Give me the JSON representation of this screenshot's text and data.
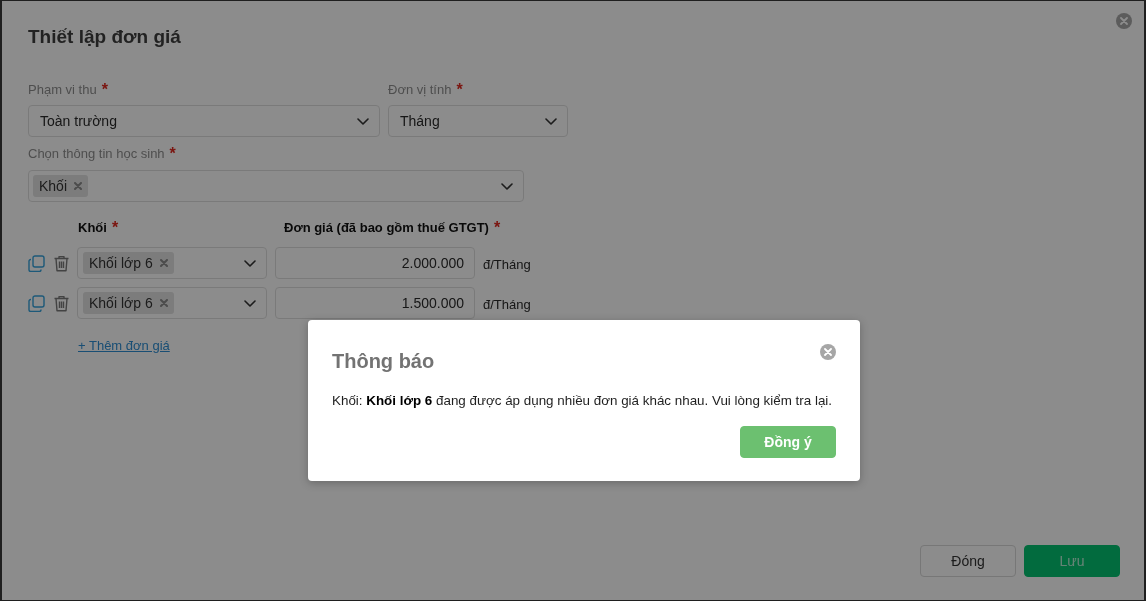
{
  "dialog": {
    "title": "Thiết lập đơn giá",
    "fields": [
      {
        "label": "Phạm vi thu",
        "required_mark": "*",
        "value": "Toàn trường"
      },
      {
        "label": "Đơn vị tính",
        "required_mark": "*",
        "value": "Tháng"
      }
    ],
    "student_info": {
      "label": "Chọn thông tin học sinh",
      "required_mark": "*",
      "tags": [
        "Khối"
      ]
    },
    "price_table": {
      "columns": [
        {
          "label": "Khối",
          "required_mark": "*"
        },
        {
          "label": "Đơn giá (đã bao gồm thuế GTGT)",
          "required_mark": "*"
        }
      ],
      "rows": [
        {
          "tags": [
            "Khối lớp 6"
          ],
          "price": "2.000.000",
          "unit": "đ/Tháng"
        },
        {
          "tags": [
            "Khối lớp 6"
          ],
          "price": "1.500.000",
          "unit": "đ/Tháng"
        }
      ]
    },
    "add_link": "+ Thêm đơn giá",
    "buttons": [
      {
        "label": "Đóng",
        "kind": "secondary"
      },
      {
        "label": "Lưu",
        "kind": "primary"
      }
    ]
  },
  "notice": {
    "title": "Thông báo",
    "message": "Khối: **Khối lớp 6** đang được áp dụng nhiều đơn giá khác nhau. Vui lòng kiểm tra lại.",
    "buttons": [
      {
        "label": "Đồng ý",
        "kind": "success"
      }
    ]
  }
}
